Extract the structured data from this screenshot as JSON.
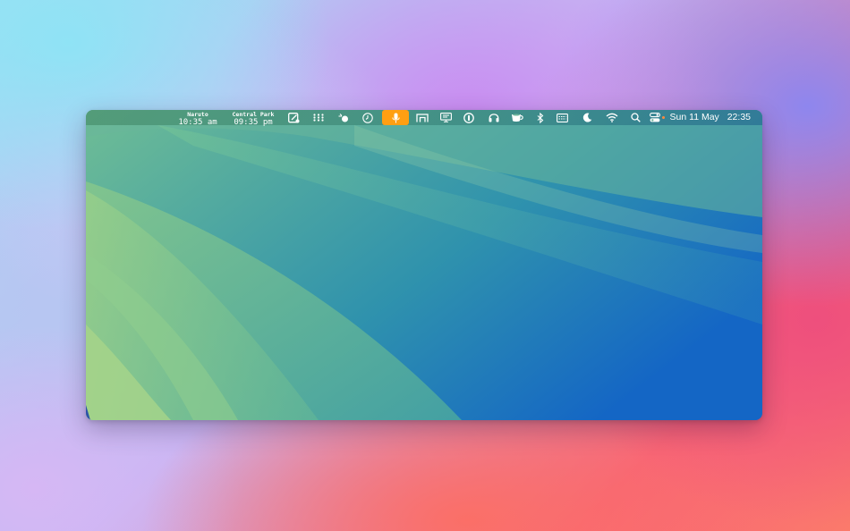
{
  "menubar": {
    "world_clocks": [
      {
        "city": "Naruto",
        "time": "10:35 am"
      },
      {
        "city": "Central Park",
        "time": "09:35 pm"
      }
    ],
    "status_icons": [
      "screenshot-edit-icon",
      "dots-grid-icon",
      "cursor-click-icon",
      "clock-icon",
      "microphone-icon",
      "stage-icon",
      "display-icon",
      "password-manager-icon",
      "headphones-icon",
      "coffee-cup-icon",
      "bluetooth-icon",
      "keyboard-icon",
      "moon-icon",
      "wifi-icon",
      "search-icon",
      "control-center-icon"
    ],
    "recording_color": "#ff9f12",
    "date": "Sun 11 May",
    "time": "22:35"
  },
  "colors": {
    "menubar_accent": "#ff9f12",
    "wallpaper_light": "#8cc98a",
    "wallpaper_dark": "#1a6ac4"
  }
}
